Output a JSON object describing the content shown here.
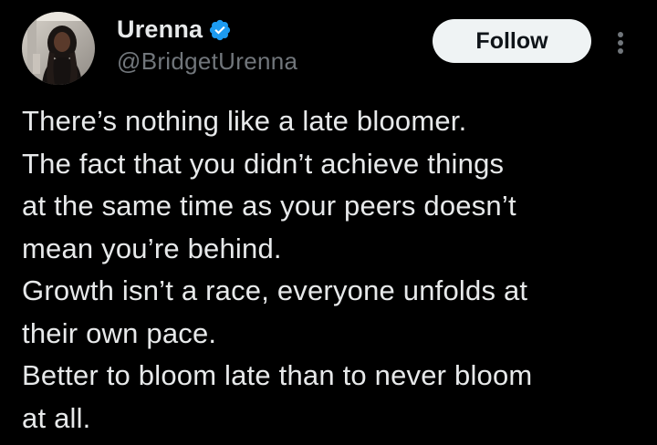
{
  "author": {
    "display_name": "Urenna",
    "handle": "@BridgetUrenna",
    "verified": true,
    "verified_color": "#1d9bf0",
    "avatar_icon": "profile-photo"
  },
  "actions": {
    "follow_label": "Follow",
    "more_icon": "vertical-ellipsis-icon"
  },
  "tweet": {
    "lines": [
      "There’s nothing like a late bloomer.",
      "The fact that you didn’t achieve things",
      "at the same time as your peers doesn’t",
      "mean you’re behind.",
      "Growth isn’t a race,  everyone unfolds at",
      "their own pace.",
      "Better to bloom late than to never bloom",
      "at all."
    ]
  },
  "colors": {
    "background": "#000000",
    "text_primary": "#e7e9ea",
    "text_secondary": "#71767b",
    "button_bg": "#eff3f4",
    "button_text": "#0f1419"
  }
}
